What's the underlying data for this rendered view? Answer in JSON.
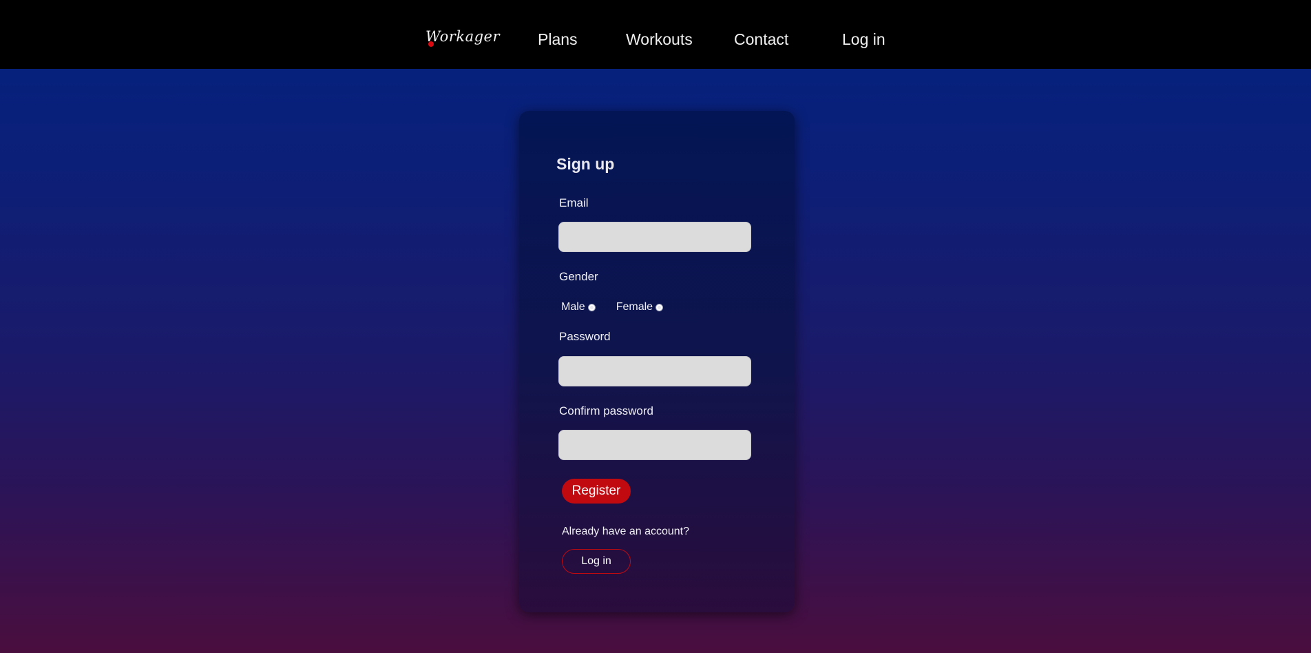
{
  "nav": {
    "logo": "Workager",
    "links": [
      "Plans",
      "Workouts",
      "Contact",
      "Log in"
    ]
  },
  "form": {
    "title": "Sign up",
    "email_label": "Email",
    "email_value": "",
    "gender_label": "Gender",
    "gender_options": [
      "Male",
      "Female"
    ],
    "password_label": "Password",
    "password_value": "",
    "confirm_label": "Confirm password",
    "confirm_value": "",
    "register_label": "Register",
    "already_text": "Already have an account?",
    "login_label": "Log in"
  },
  "colors": {
    "accent": "#c10a10",
    "nav_background": "#000000",
    "input_background": "#dcdcdc",
    "gradient_top": "#01237f",
    "gradient_bottom": "#4a0e3e"
  },
  "icons": {
    "logo_mark": "red-dot-icon",
    "radio": "radio-button-icon"
  }
}
